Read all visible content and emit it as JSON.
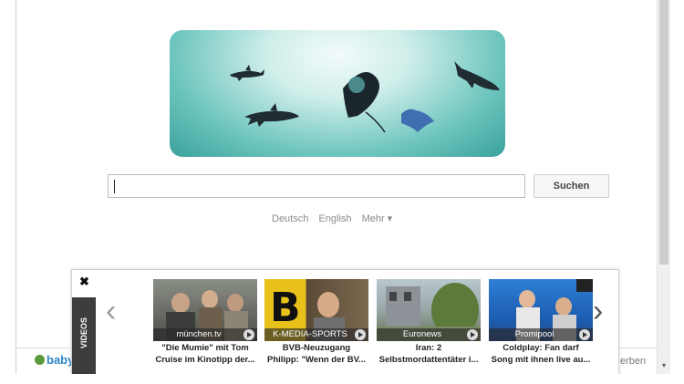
{
  "search": {
    "button_label": "Suchen",
    "value": ""
  },
  "languages": [
    "Deutsch",
    "English",
    "Mehr ▾"
  ],
  "video_panel": {
    "close_label": "✖",
    "tab_label": "VIDEOS",
    "prev_label": "‹",
    "next_label": "›",
    "videos": [
      {
        "source": "münchen.tv",
        "caption_line1": "\"Die Mumie\" mit Tom",
        "caption_line2": "Cruise im Kinotipp der..."
      },
      {
        "source": "K-MEDIA-SPORTS",
        "caption_line1": "BVB-Neuzugang",
        "caption_line2": "Philipp: \"Wenn der BV..."
      },
      {
        "source": "Euronews",
        "caption_line1": "Iran: 2",
        "caption_line2": "Selbstmordattentäter i..."
      },
      {
        "source": "Promipool",
        "caption_line1": "Coldplay: Fan darf",
        "caption_line2": "Song mit ihnen live au..."
      }
    ]
  },
  "footer": {
    "logo_text": "baby",
    "right_text": "erben"
  },
  "colors": {
    "logo_teal": "#3aa29b",
    "link_blue": "#2a86c9",
    "panel_dark": "#3d3d3d"
  }
}
